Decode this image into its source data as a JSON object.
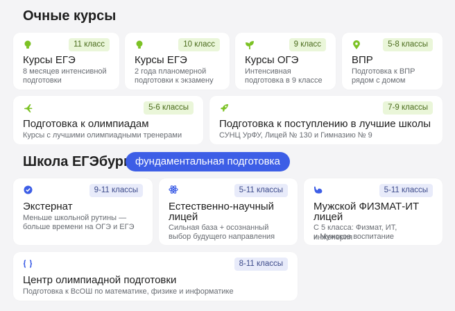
{
  "section1": {
    "title": "Очные курсы"
  },
  "section2": {
    "title": "Школа ЕГЭбург",
    "pill": "фундаментальная подготовка"
  },
  "colors": {
    "green_icon": "#7cc225",
    "blue_icon": "#3d5ee6",
    "pill_bg": "#3d5ee6"
  },
  "cards": [
    {
      "icon": "lightbulb-icon",
      "badge": "11 класс",
      "title": "Курсы ЕГЭ",
      "desc1": "8 месяцев интенсивной",
      "desc2": "подготовки"
    },
    {
      "icon": "lightbulb-icon",
      "badge": "10 класс",
      "title": "Курсы ЕГЭ",
      "desc1": "2 года планомерной",
      "desc2": "подготовки к экзамену"
    },
    {
      "icon": "sprout-icon",
      "badge": "9 класс",
      "title": "Курсы ОГЭ",
      "desc1": "Интенсивная",
      "desc2": "подготовка в 9 классе"
    },
    {
      "icon": "location-pin-icon",
      "badge": "5-8 классы",
      "title": "ВПР",
      "desc1": "Подготовка к ВПР",
      "desc2": "рядом с домом"
    },
    {
      "icon": "airplane-icon",
      "badge": "5-6 классы",
      "title": "Подготовка к олимпиадам",
      "desc1": "Курсы с лучшими олимпиадными тренерами"
    },
    {
      "icon": "rocket-icon",
      "badge": "7-9 классы",
      "title": "Подготовка к поступлению в лучшие школы",
      "desc1": "СУНЦ УрФУ, Лицей № 130 и Гимназию № 9"
    },
    {
      "icon": "check-badge-icon",
      "badge": "9-11 классы",
      "title": "Экстернат",
      "desc1": "Меньше школьной рутины —",
      "desc2": "больше времени на ОГЭ и ЕГЭ"
    },
    {
      "icon": "atom-icon",
      "badge": "5-11 классы",
      "title1": "Естественно-научный",
      "title2": "лицей",
      "desc1": "Сильная база + осознанный",
      "desc2": "выбор будущего направления"
    },
    {
      "icon": "bicep-icon",
      "badge": "5-11 классы",
      "title1": "Мужской ФИЗМАТ-ИТ",
      "title2": "лицей",
      "desc1": "С 5 класса: Физмат, ИТ, инженерия",
      "desc2": "и Мужское воспитание"
    },
    {
      "icon": "code-braces-icon",
      "badge": "8-11 классы",
      "title": "Центр олимпиадной подготовки",
      "desc1": "Подготовка к ВсОШ по математике, физике и информатике"
    }
  ]
}
